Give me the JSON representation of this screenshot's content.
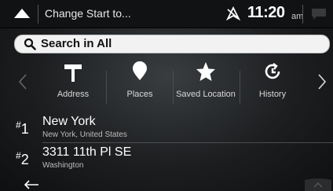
{
  "header": {
    "title": "Change Start to...",
    "time": "11:20",
    "ampm": "am"
  },
  "search": {
    "label": "Search in All"
  },
  "categories": [
    {
      "label": "Address",
      "icon": "signpost-icon"
    },
    {
      "label": "Places",
      "icon": "pin-icon"
    },
    {
      "label": "Saved Location",
      "icon": "star-icon"
    },
    {
      "label": "History",
      "icon": "history-icon"
    }
  ],
  "results": [
    {
      "rank": "1",
      "name": "New York",
      "detail": "New York, United States"
    },
    {
      "rank": "2",
      "name": "3311 11th Pl SE",
      "detail": "Washington"
    }
  ],
  "colors": {
    "background": "#2a2c2e",
    "topbar": "#111213",
    "search_field": "#f2f2f2"
  }
}
